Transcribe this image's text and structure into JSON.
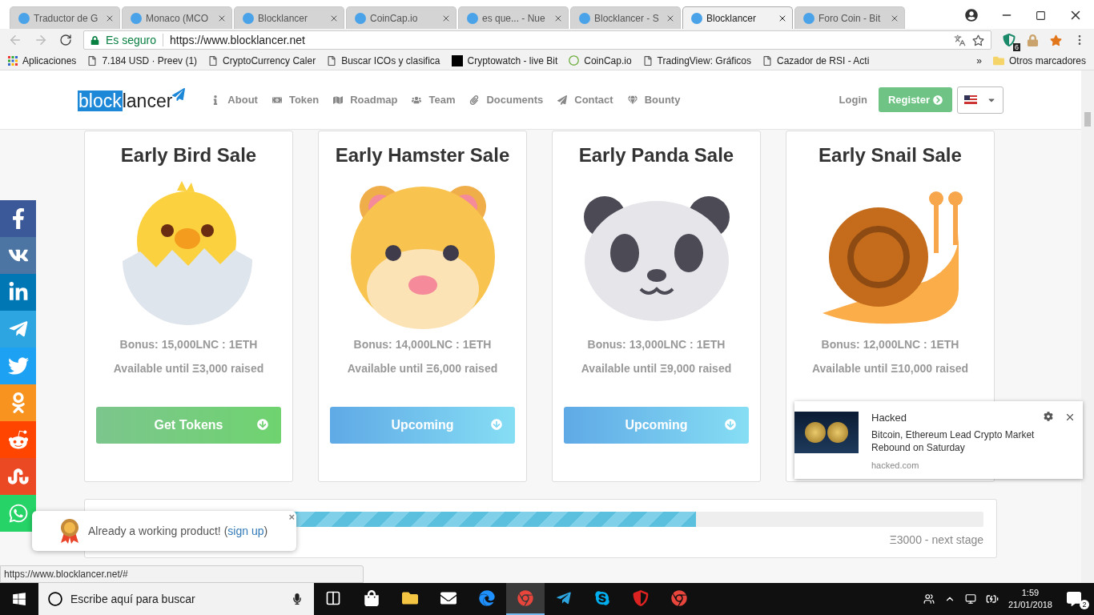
{
  "browser": {
    "tabs": [
      {
        "title": "Traductor de G",
        "selected": false
      },
      {
        "title": "Monaco (MCO",
        "selected": false
      },
      {
        "title": "Blocklancer",
        "selected": false
      },
      {
        "title": "CoinCap.io",
        "selected": false
      },
      {
        "title": "es que... - Nue",
        "selected": false
      },
      {
        "title": "Blocklancer - S",
        "selected": false
      },
      {
        "title": "Blocklancer",
        "selected": true
      },
      {
        "title": "Foro Coin - Bit",
        "selected": false
      }
    ],
    "secure_label": "Es seguro",
    "url": "https://www.blocklancer.net",
    "extension_badge": "6",
    "bookmarks": [
      {
        "label": "Aplicaciones",
        "kind": "apps"
      },
      {
        "label": "7.184 USD · Preev (1)",
        "kind": "page"
      },
      {
        "label": "CryptoCurrency Caler",
        "kind": "page"
      },
      {
        "label": "Buscar ICOs y clasifica",
        "kind": "page"
      },
      {
        "label": "Cryptowatch - live Bit",
        "kind": "site"
      },
      {
        "label": "CoinCap.io",
        "kind": "coin"
      },
      {
        "label": "TradingView: Gráficos",
        "kind": "page"
      },
      {
        "label": "Cazador de RSI - Acti",
        "kind": "page"
      }
    ],
    "more": "»",
    "other_bookmarks": "Otros marcadores"
  },
  "header": {
    "logo_a": "block",
    "logo_b": "lancer",
    "nav": [
      "About",
      "Token",
      "Roadmap",
      "Team",
      "Documents",
      "Contact",
      "Bounty"
    ],
    "login": "Login",
    "register": "Register"
  },
  "cards": [
    {
      "title": "Early Bird Sale",
      "kind": "chick",
      "bonus": "Bonus: 15,000LNC : 1ETH",
      "available": "Available until Ξ3,000 raised",
      "button": {
        "label": "Get Tokens",
        "kind": "active"
      }
    },
    {
      "title": "Early Hamster Sale",
      "kind": "hamster",
      "bonus": "Bonus: 14,000LNC : 1ETH",
      "available": "Available until Ξ6,000 raised",
      "button": {
        "label": "Upcoming",
        "kind": "upcoming"
      }
    },
    {
      "title": "Early Panda Sale",
      "kind": "panda",
      "bonus": "Bonus: 13,000LNC : 1ETH",
      "available": "Available until Ξ9,000 raised",
      "button": {
        "label": "Upcoming",
        "kind": "upcoming"
      }
    },
    {
      "title": "Early Snail Sale",
      "kind": "snail",
      "bonus": "Bonus: 12,000LNC : 1ETH",
      "available": "Available until Ξ10,000 raised"
    }
  ],
  "progress": {
    "level": 0.675,
    "label": "Ξ3000 - next stage"
  },
  "social": [
    {
      "kind": "facebook",
      "color": "#3b5998"
    },
    {
      "kind": "vk",
      "color": "#4c75a3"
    },
    {
      "kind": "linkedin",
      "color": "#0077b5"
    },
    {
      "kind": "telegram",
      "color": "#2ca5e0"
    },
    {
      "kind": "twitter",
      "color": "#1da1f2"
    },
    {
      "kind": "odnoklassniki",
      "color": "#f7931e"
    },
    {
      "kind": "reddit",
      "color": "#ff4500"
    },
    {
      "kind": "stumbleupon",
      "color": "#eb4924"
    },
    {
      "kind": "whatsapp",
      "color": "#25d366"
    }
  ],
  "toast": {
    "before": "Already a working product! (",
    "link": "sign up",
    "after": ")",
    "close": "×"
  },
  "notification": {
    "source": "Hacked",
    "headline": "Bitcoin, Ethereum Lead Crypto Market Rebound on Saturday",
    "domain": "hacked.com"
  },
  "status_url": "https://www.blocklancer.net/#",
  "taskbar": {
    "search_placeholder": "Escribe aquí para buscar",
    "apps": [
      {
        "kind": "taskview",
        "selected": false
      },
      {
        "kind": "store",
        "selected": false
      },
      {
        "kind": "folder",
        "selected": false
      },
      {
        "kind": "mail",
        "selected": false
      },
      {
        "kind": "edge",
        "selected": false
      },
      {
        "kind": "chrome",
        "selected": true
      },
      {
        "kind": "telegram",
        "selected": false
      },
      {
        "kind": "skype",
        "selected": false
      },
      {
        "kind": "antivirus",
        "selected": false
      },
      {
        "kind": "chrome",
        "selected": false
      }
    ],
    "time": "1:59",
    "date": "21/01/2018",
    "notifications": "2"
  }
}
